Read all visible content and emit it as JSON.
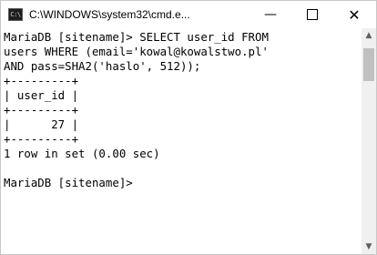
{
  "window": {
    "title": "C:\\WINDOWS\\system32\\cmd.e...",
    "app_icon_text": "C:\\",
    "controls": {
      "minimize": "—",
      "close": "✕"
    }
  },
  "console": {
    "lines": [
      "MariaDB [sitename]> SELECT user_id FROM",
      "users WHERE (email='kowal@kowalstwo.pl'",
      "AND pass=SHA2('haslo', 512));",
      "+---------+",
      "| user_id |",
      "+---------+",
      "|      27 |",
      "+---------+",
      "1 row in set (0.00 sec)",
      "",
      "MariaDB [sitename]>"
    ]
  },
  "scrollbar": {
    "up_arrow": "▲",
    "down_arrow": "▼"
  }
}
